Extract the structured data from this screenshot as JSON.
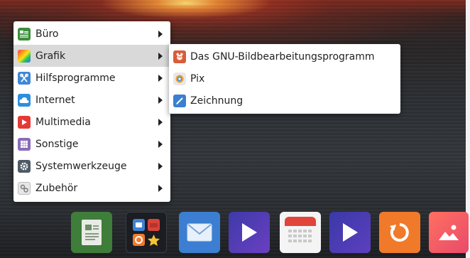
{
  "menu": {
    "items": [
      {
        "label": "Büro",
        "icon": "office-icon",
        "active": false
      },
      {
        "label": "Grafik",
        "icon": "graphics-icon",
        "active": true
      },
      {
        "label": "Hilfsprogramme",
        "icon": "accessories-icon",
        "active": false
      },
      {
        "label": "Internet",
        "icon": "internet-icon",
        "active": false
      },
      {
        "label": "Multimedia",
        "icon": "multimedia-icon",
        "active": false
      },
      {
        "label": "Sonstige",
        "icon": "other-icon",
        "active": false
      },
      {
        "label": "Systemwerkzeuge",
        "icon": "system-tools-icon",
        "active": false
      },
      {
        "label": "Zubehör",
        "icon": "utilities-icon",
        "active": false
      }
    ]
  },
  "submenu": {
    "items": [
      {
        "label": "Das GNU-Bildbearbeitungsprogramm",
        "icon": "gimp-icon"
      },
      {
        "label": "Pix",
        "icon": "pix-icon"
      },
      {
        "label": "Zeichnung",
        "icon": "drawing-icon"
      }
    ]
  },
  "dock": {
    "icons": [
      "office-suite-icon",
      "app-launcher-icon",
      "mail-icon",
      "media-player-icon",
      "calendar-icon",
      "video-player-icon",
      "backup-icon",
      "image-viewer-icon"
    ]
  }
}
